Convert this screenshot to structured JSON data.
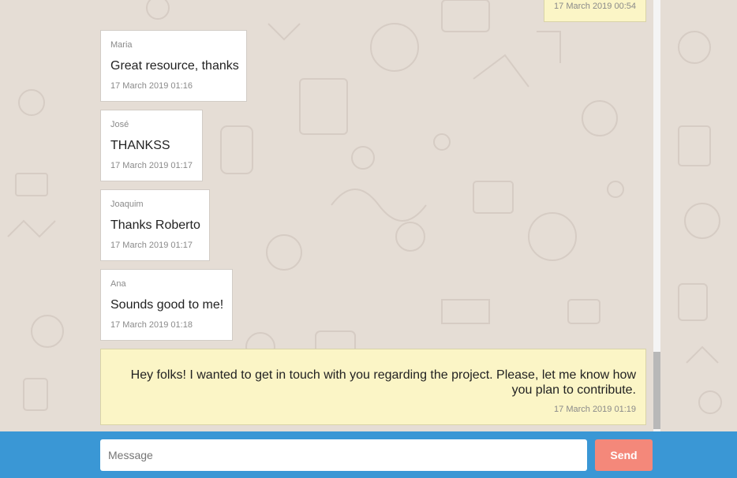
{
  "colors": {
    "background": "#e5ddd5",
    "incoming_bubble": "#ffffff",
    "own_bubble": "#fbf5c6",
    "composer_bar": "#3a97d5",
    "send_button": "#f4887a"
  },
  "top_message": {
    "time": "17 March 2019 00:54"
  },
  "messages": [
    {
      "sender": "Maria",
      "text": "Great resource, thanks",
      "time": "17 March 2019 01:16"
    },
    {
      "sender": "José",
      "text": "THANKSS",
      "time": "17 March 2019 01:17"
    },
    {
      "sender": "Joaquim",
      "text": "Thanks Roberto",
      "time": "17 March 2019 01:17"
    },
    {
      "sender": "Ana",
      "text": "Sounds good to me!",
      "time": "17 March 2019 01:18"
    }
  ],
  "own_message": {
    "text": "Hey folks! I wanted to get in touch with you regarding the project. Please, let me know how you plan to contribute.",
    "time": "17 March 2019 01:19"
  },
  "composer": {
    "placeholder": "Message",
    "send_label": "Send"
  }
}
